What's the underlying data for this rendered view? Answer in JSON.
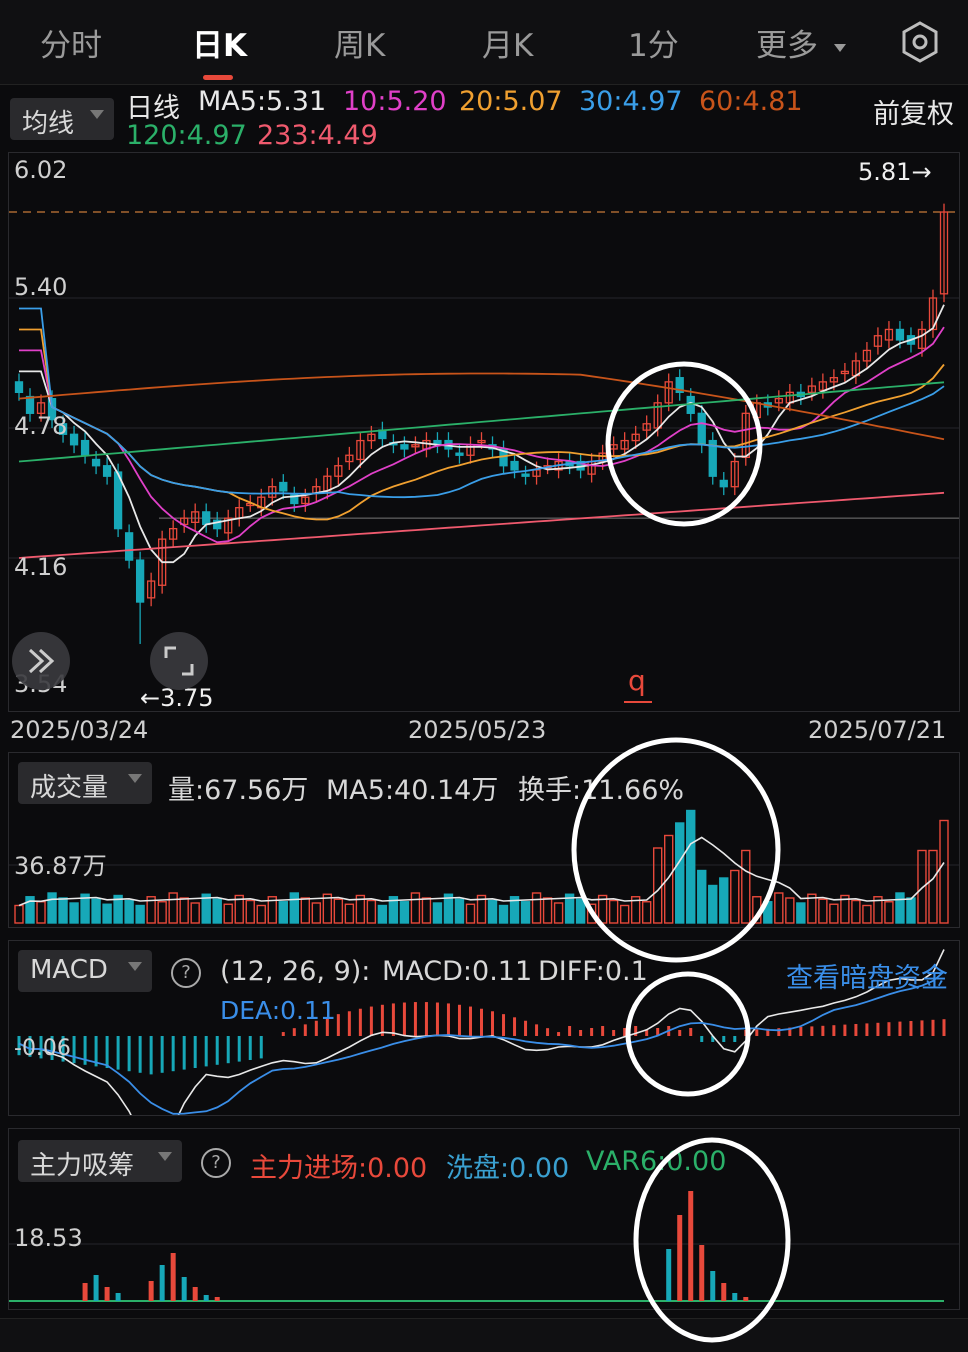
{
  "tabs": [
    {
      "label": "分时",
      "active": false
    },
    {
      "label": "日K",
      "active": true
    },
    {
      "label": "周K",
      "active": false
    },
    {
      "label": "月K",
      "active": false
    },
    {
      "label": "1分",
      "active": false
    },
    {
      "label": "更多",
      "active": false
    }
  ],
  "settings_icon": "gear-icon",
  "ma_legend": {
    "selector_label": "均线",
    "series_label": "日线",
    "items": [
      {
        "text": "MA5:5.31",
        "color": "#e8e8e8"
      },
      {
        "text": "10:5.20",
        "color": "#e040c8"
      },
      {
        "text": "20:5.07",
        "color": "#f0a030"
      },
      {
        "text": "30:4.97",
        "color": "#3a9ee8"
      },
      {
        "text": "60:4.81",
        "color": "#c8541a"
      },
      {
        "text": "120:4.97",
        "color": "#2bb069"
      },
      {
        "text": "233:4.49",
        "color": "#f05a6e"
      }
    ],
    "adjust_label": "前复权"
  },
  "price_panel": {
    "y_labels": [
      "6.02",
      "5.40",
      "4.78",
      "4.16",
      "3.54"
    ],
    "high_marker": "5.81→",
    "low_marker": "←3.75",
    "annotation": "q",
    "x_labels": [
      "2025/03/24",
      "2025/05/23",
      "2025/07/21"
    ]
  },
  "volume_panel": {
    "selector_label": "成交量",
    "legend": [
      {
        "text": "量:67.56万",
        "color": "#d8d8d8"
      },
      {
        "text": "MA5:40.14万",
        "color": "#d8d8d8"
      },
      {
        "text": "换手:11.66%",
        "color": "#d8d8d8"
      }
    ],
    "y_label": "36.87万"
  },
  "macd_panel": {
    "selector_label": "MACD",
    "params": "(12, 26, 9):",
    "legend": [
      {
        "text": "MACD:0.11",
        "color": "#d8d8d8"
      },
      {
        "text": "DIFF:0.1",
        "color": "#d8d8d8"
      }
    ],
    "dea": "DEA:0.11",
    "link": "查看暗盘资金",
    "y_label": "-0.06"
  },
  "flow_panel": {
    "selector_label": "主力吸筹",
    "legend": [
      {
        "text": "主力进场:0.00",
        "color": "#e8493b"
      },
      {
        "text": "洗盘:0.00",
        "color": "#3aa0d0"
      },
      {
        "text": "VAR6:0.00",
        "color": "#2bb069"
      }
    ],
    "y_label": "18.53"
  },
  "colors": {
    "up": "#e8493b",
    "down": "#17a8b8",
    "bg": "#0b0b0d"
  },
  "chart_data": {
    "type": "line",
    "title": "",
    "x_range": [
      "2025/03/24",
      "2025/07/21"
    ],
    "ylim": [
      3.54,
      6.02
    ],
    "candles_close_approx": [
      4.95,
      4.85,
      4.9,
      4.82,
      4.75,
      4.7,
      4.65,
      4.6,
      4.55,
      4.3,
      4.15,
      3.95,
      4.05,
      4.25,
      4.3,
      4.35,
      4.38,
      4.32,
      4.3,
      4.35,
      4.4,
      4.42,
      4.45,
      4.5,
      4.48,
      4.42,
      4.45,
      4.5,
      4.55,
      4.6,
      4.65,
      4.72,
      4.75,
      4.73,
      4.7,
      4.68,
      4.7,
      4.72,
      4.7,
      4.68,
      4.65,
      4.7,
      4.72,
      4.68,
      4.6,
      4.58,
      4.55,
      4.58,
      4.6,
      4.62,
      4.6,
      4.58,
      4.62,
      4.66,
      4.7,
      4.72,
      4.75,
      4.8,
      4.9,
      5.0,
      4.95,
      4.85,
      4.7,
      4.55,
      4.5,
      4.62,
      4.85,
      4.9,
      4.88,
      4.92,
      4.95,
      4.93,
      4.98,
      5.0,
      5.02,
      5.05,
      5.1,
      5.15,
      5.22,
      5.25,
      5.2,
      5.18,
      5.25,
      5.4,
      5.81
    ],
    "series": [
      {
        "name": "MA5",
        "color": "#e8e8e8"
      },
      {
        "name": "10",
        "color": "#e040c8"
      },
      {
        "name": "20",
        "color": "#f0a030"
      },
      {
        "name": "30",
        "color": "#3a9ee8"
      },
      {
        "name": "60",
        "color": "#c8541a"
      },
      {
        "name": "120",
        "color": "#2bb069"
      },
      {
        "name": "233",
        "color": "#f05a6e"
      }
    ]
  }
}
